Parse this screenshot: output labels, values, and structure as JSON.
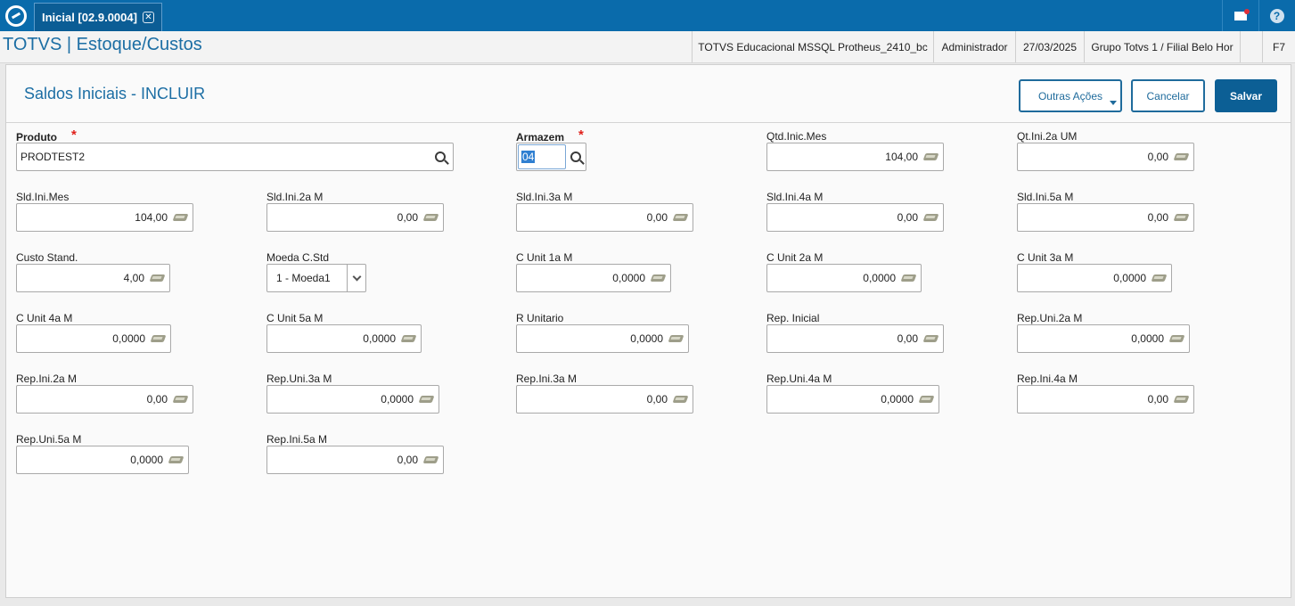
{
  "topbar": {
    "tab_label": "Inicial [02.9.0004]",
    "tab_close": "✕",
    "help": "?"
  },
  "header": {
    "module_title": "TOTVS | Estoque/Custos",
    "environment": "TOTVS Educacional MSSQL Protheus_2410_bc",
    "user": "Administrador",
    "date": "27/03/2025",
    "branch": "Grupo Totvs 1 / Filial Belo Hor",
    "shortcut": "F7"
  },
  "form": {
    "title": "Saldos Iniciais - INCLUIR",
    "buttons": {
      "other_actions": "Outras Ações",
      "cancel": "Cancelar",
      "save": "Salvar"
    },
    "required_mark": "*",
    "fields": {
      "produto": {
        "label": "Produto",
        "value": "PRODTEST2"
      },
      "armazem": {
        "label": "Armazem",
        "value": "04"
      },
      "qtd_inic_mes": {
        "label": "Qtd.Inic.Mes",
        "value": "104,00"
      },
      "qt_ini_2a_um": {
        "label": "Qt.Ini.2a UM",
        "value": "0,00"
      },
      "sld_ini_mes": {
        "label": "Sld.Ini.Mes",
        "value": "104,00"
      },
      "sld_ini_2a_m": {
        "label": "Sld.Ini.2a M",
        "value": "0,00"
      },
      "sld_ini_3a_m": {
        "label": "Sld.Ini.3a M",
        "value": "0,00"
      },
      "sld_ini_4a_m": {
        "label": "Sld.Ini.4a M",
        "value": "0,00"
      },
      "sld_ini_5a_m": {
        "label": "Sld.Ini.5a M",
        "value": "0,00"
      },
      "custo_stand": {
        "label": "Custo Stand.",
        "value": "4,00"
      },
      "moeda_c_std": {
        "label": "Moeda C.Std",
        "value": "1 - Moeda1"
      },
      "c_unit_1a_m": {
        "label": "C Unit 1a M",
        "value": "0,0000"
      },
      "c_unit_2a_m": {
        "label": "C Unit 2a M",
        "value": "0,0000"
      },
      "c_unit_3a_m": {
        "label": "C Unit 3a M",
        "value": "0,0000"
      },
      "c_unit_4a_m": {
        "label": "C Unit 4a M",
        "value": "0,0000"
      },
      "c_unit_5a_m": {
        "label": "C Unit 5a M",
        "value": "0,0000"
      },
      "r_unitario": {
        "label": "R Unitario",
        "value": "0,0000"
      },
      "rep_inicial": {
        "label": "Rep. Inicial",
        "value": "0,00"
      },
      "rep_uni_2a_m": {
        "label": "Rep.Uni.2a M",
        "value": "0,0000"
      },
      "rep_ini_2a_m": {
        "label": "Rep.Ini.2a M",
        "value": "0,00"
      },
      "rep_uni_3a_m": {
        "label": "Rep.Uni.3a M",
        "value": "0,0000"
      },
      "rep_ini_3a_m": {
        "label": "Rep.Ini.3a M",
        "value": "0,00"
      },
      "rep_uni_4a_m": {
        "label": "Rep.Uni.4a M",
        "value": "0,0000"
      },
      "rep_ini_4a_m": {
        "label": "Rep.Ini.4a M",
        "value": "0,00"
      },
      "rep_uni_5a_m": {
        "label": "Rep.Uni.5a M",
        "value": "0,0000"
      },
      "rep_ini_5a_m": {
        "label": "Rep.Ini.5a M",
        "value": "0,00"
      }
    }
  }
}
